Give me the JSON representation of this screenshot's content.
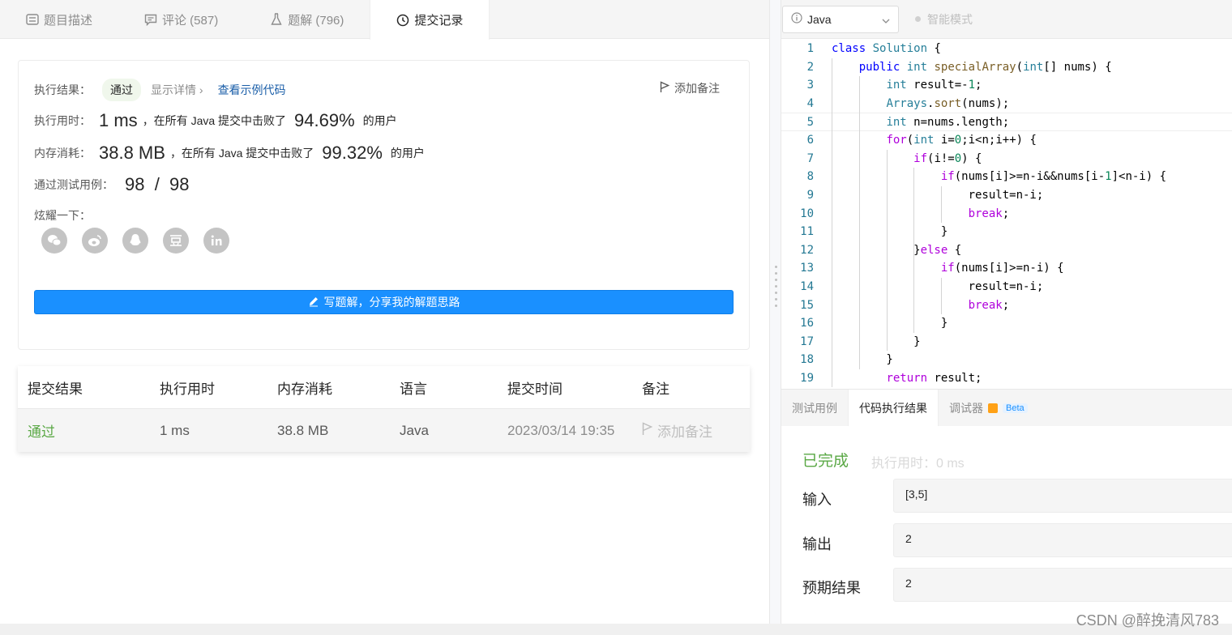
{
  "tabs": [
    {
      "label": "题目描述",
      "icon": "description-icon"
    },
    {
      "label": "评论 (587)",
      "icon": "comment-icon"
    },
    {
      "label": "题解 (796)",
      "icon": "flask-icon"
    },
    {
      "label": "提交记录",
      "icon": "clock-icon"
    }
  ],
  "result": {
    "label": "执行结果：",
    "status": "通过",
    "show_details": "显示详情 ›",
    "view_sample": "查看示例代码",
    "add_note": "添加备注",
    "runtime_label": "执行用时：",
    "runtime_value": "1 ms",
    "runtime_text": "，在所有 Java 提交中击败了",
    "runtime_pct": "94.69%",
    "runtime_suffix": "的用户",
    "memory_label": "内存消耗：",
    "memory_value": "38.8 MB",
    "memory_text": "，在所有 Java 提交中击败了",
    "memory_pct": "99.32%",
    "memory_suffix": "的用户",
    "tests_label": "通过测试用例：",
    "tests_value": "98  /  98",
    "share_label": "炫耀一下：",
    "share_icons": [
      "wechat-icon",
      "weibo-icon",
      "qq-icon",
      "douban-icon",
      "linkedin-icon"
    ],
    "write_button": "写题解，分享我的解题思路"
  },
  "submissions": {
    "headers": [
      "提交结果",
      "执行用时",
      "内存消耗",
      "语言",
      "提交时间",
      "备注"
    ],
    "rows": [
      {
        "result": "通过",
        "time": "1 ms",
        "memory": "38.8 MB",
        "lang": "Java",
        "submitted": "2023/03/14 19:35",
        "note": "添加备注"
      }
    ]
  },
  "editor": {
    "language": "Java",
    "smart_mode": "智能模式",
    "current_line": 5,
    "lines": [
      "class Solution {",
      "    public int specialArray(int[] nums) {",
      "        int result=-1;",
      "        Arrays.sort(nums);",
      "        int n=nums.length;",
      "        for(int i=0;i<n;i++) {",
      "            if(i!=0) {",
      "                if(nums[i]>=n-i&&nums[i-1]<n-i) {",
      "                    result=n-i;",
      "                    break;",
      "                }",
      "            }else {",
      "                if(nums[i]>=n-i) {",
      "                    result=n-i;",
      "                    break;",
      "                }",
      "            }",
      "        }",
      "        return result;"
    ]
  },
  "console": {
    "tabs": [
      "测试用例",
      "代码执行结果",
      "调试器"
    ],
    "beta": "Beta",
    "status": "已完成",
    "exec_time": "执行用时：0 ms",
    "input_label": "输入",
    "input_value": "[3,5]",
    "output_label": "输出",
    "output_value": "2",
    "expected_label": "预期结果",
    "expected_value": "2"
  },
  "watermark": "CSDN @醉挽清风783",
  "colors": {
    "accent": "#1a90ff",
    "pass": "#5aa845"
  }
}
